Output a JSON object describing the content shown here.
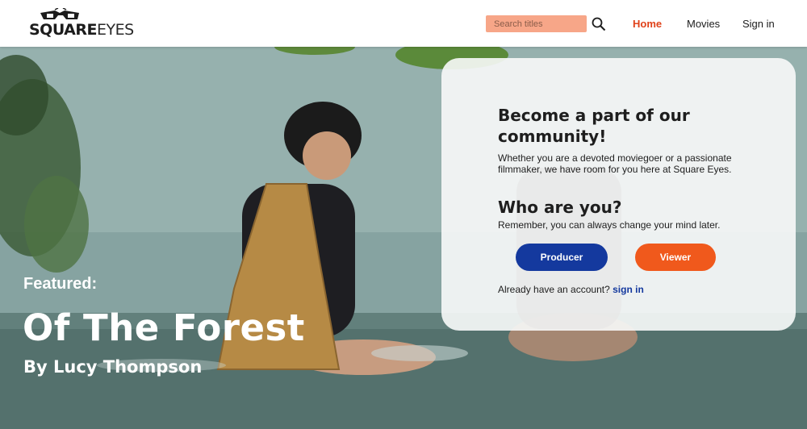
{
  "header": {
    "logo": {
      "word_bold": "SQUARE",
      "word_thin": "EYES"
    },
    "search": {
      "placeholder": "Search titles",
      "value": ""
    },
    "nav": [
      {
        "label": "Home",
        "active": true
      },
      {
        "label": "Movies",
        "active": false
      },
      {
        "label": "Sign in",
        "active": false
      }
    ]
  },
  "hero": {
    "featured_label": "Featured:",
    "featured_title": "Of The Forest",
    "featured_author": "By Lucy Thompson"
  },
  "card": {
    "heading": "Become a part of our community!",
    "description": "Whether you are a devoted moviegoer or a passionate filmmaker, we have room for you here at Square Eyes.",
    "subheading": "Who are you?",
    "subdescription": "Remember, you can always change your mind later.",
    "producer_label": "Producer",
    "viewer_label": "Viewer",
    "signin_prompt": "Already have an account?",
    "signin_link": "sign in"
  },
  "colors": {
    "accent_orange": "#f0591c",
    "nav_active": "#e0421a",
    "search_bg": "#f7a688",
    "primary_blue": "#14399e"
  },
  "icons": [
    "square-eyes-logo",
    "search-icon"
  ]
}
